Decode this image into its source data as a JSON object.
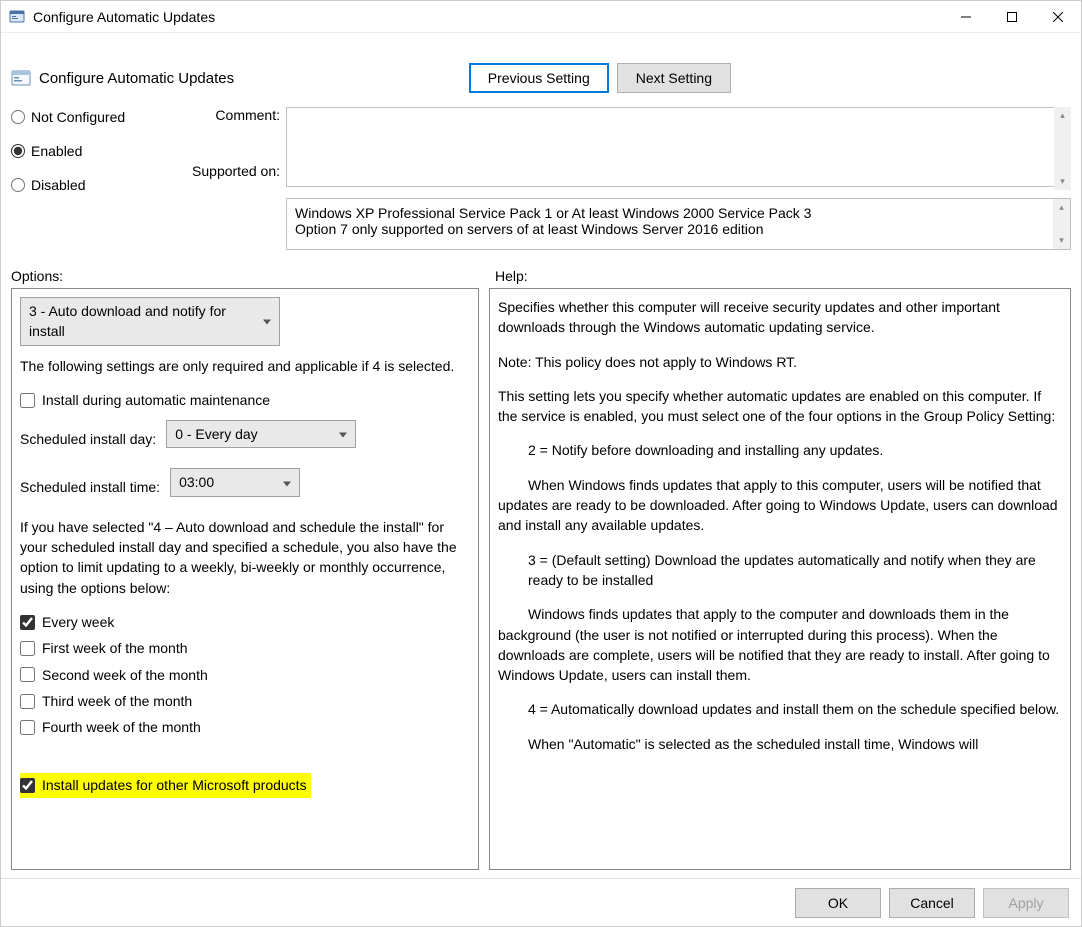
{
  "window": {
    "title": "Configure Automatic Updates"
  },
  "header": {
    "policy_title": "Configure Automatic Updates",
    "prev_btn": "Previous Setting",
    "next_btn": "Next Setting"
  },
  "state": {
    "not_configured": "Not Configured",
    "enabled": "Enabled",
    "disabled": "Disabled",
    "selected": "enabled",
    "comment_label": "Comment:",
    "comment_value": "",
    "supported_label": "Supported on:",
    "supported_text_1": "Windows XP Professional Service Pack 1 or At least Windows 2000 Service Pack 3",
    "supported_text_2": "Option 7 only supported on servers of at least Windows Server 2016 edition"
  },
  "section_labels": {
    "options": "Options:",
    "help": "Help:"
  },
  "options": {
    "top_dropdown": "3 - Auto download and notify for install",
    "note_4": "The following settings are only required and applicable if 4 is selected.",
    "install_during_maint": "Install during automatic maintenance",
    "sched_day_label": "Scheduled install day:",
    "sched_day_value": "0 - Every day",
    "sched_time_label": "Scheduled install time:",
    "sched_time_value": "03:00",
    "limit_note": "If you have selected \"4 – Auto download and schedule the install\" for your scheduled install day and specified a schedule, you also have the option to limit updating to a weekly, bi-weekly or monthly occurrence, using the options below:",
    "every_week": "Every week",
    "first_week": "First week of the month",
    "second_week": "Second week of the month",
    "third_week": "Third week of the month",
    "fourth_week": "Fourth week of the month",
    "other_products": "Install updates for other Microsoft products"
  },
  "help": {
    "p1": "Specifies whether this computer will receive security updates and other important downloads through the Windows automatic updating service.",
    "p2": "Note: This policy does not apply to Windows RT.",
    "p3": "This setting lets you specify whether automatic updates are enabled on this computer. If the service is enabled, you must select one of the four options in the Group Policy Setting:",
    "opt2_head": "2 = Notify before downloading and installing any updates.",
    "opt2_body": "When Windows finds updates that apply to this computer, users will be notified that updates are ready to be downloaded. After going to Windows Update, users can download and install any available updates.",
    "opt3_head": "3 = (Default setting) Download the updates automatically and notify when they are ready to be installed",
    "opt3_body": "Windows finds updates that apply to the computer and downloads them in the background (the user is not notified or interrupted during this process). When the downloads are complete, users will be notified that they are ready to install. After going to Windows Update, users can install them.",
    "opt4_head": "4 = Automatically download updates and install them on the schedule specified below.",
    "opt4_body": "When \"Automatic\" is selected as the scheduled install time, Windows will"
  },
  "footer": {
    "ok": "OK",
    "cancel": "Cancel",
    "apply": "Apply"
  }
}
